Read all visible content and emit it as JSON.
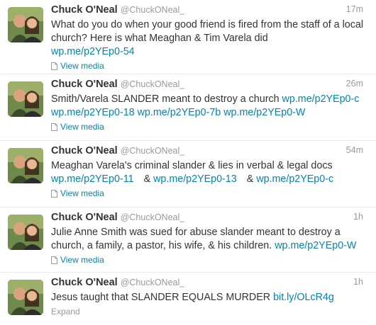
{
  "tweets": [
    {
      "fullname": "Chuck O'Neal",
      "username": "@ChuckONeal_",
      "time": "17m",
      "text_parts": [
        "What do you do when your good friend is fired from the staff of a local church? Here is what Meaghan & Tim Varela did"
      ],
      "links": [
        "wp.me/p2YEp0-54"
      ],
      "action": "View media",
      "action_icon": "document-icon"
    },
    {
      "fullname": "Chuck O'Neal",
      "username": "@ChuckONeal_",
      "time": "26m",
      "text_parts": [
        "Smith/Varela SLANDER meant to destroy a church "
      ],
      "links": [
        "wp.me/p2YEp0-c",
        "wp.me/p2YEp0-18",
        "wp.me/p2YEp0-7b",
        "wp.me/p2YEp0-W"
      ],
      "action": "View media",
      "action_icon": "document-icon"
    },
    {
      "fullname": "Chuck O'Neal",
      "username": "@ChuckONeal_",
      "time": "54m",
      "text_parts": [
        "Meaghan Varela's criminal slander & lies in verbal & legal docs",
        "&",
        "&"
      ],
      "links": [
        "wp.me/p2YEp0-11",
        "wp.me/p2YEp0-13",
        "wp.me/p2YEp0-c"
      ],
      "action": "View media",
      "action_icon": "document-icon"
    },
    {
      "fullname": "Chuck O'Neal",
      "username": "@ChuckONeal_",
      "time": "1h",
      "text_parts": [
        "Julie Anne Smith was sued for abuse slander meant to destroy a church, a family, a pastor, his wife, & his children. "
      ],
      "links": [
        "wp.me/p2YEp0-W"
      ],
      "action": "View media",
      "action_icon": "document-icon"
    },
    {
      "fullname": "Chuck O'Neal",
      "username": "@ChuckONeal_",
      "time": "1h",
      "text_parts": [
        "Jesus taught that SLANDER EQUALS MURDER "
      ],
      "links": [
        "bit.ly/OLcR4g"
      ],
      "action": "Expand"
    }
  ],
  "colors": {
    "link": "#0084b4",
    "meta": "#999999",
    "text": "#333333",
    "divider": "#e8e8e8"
  }
}
